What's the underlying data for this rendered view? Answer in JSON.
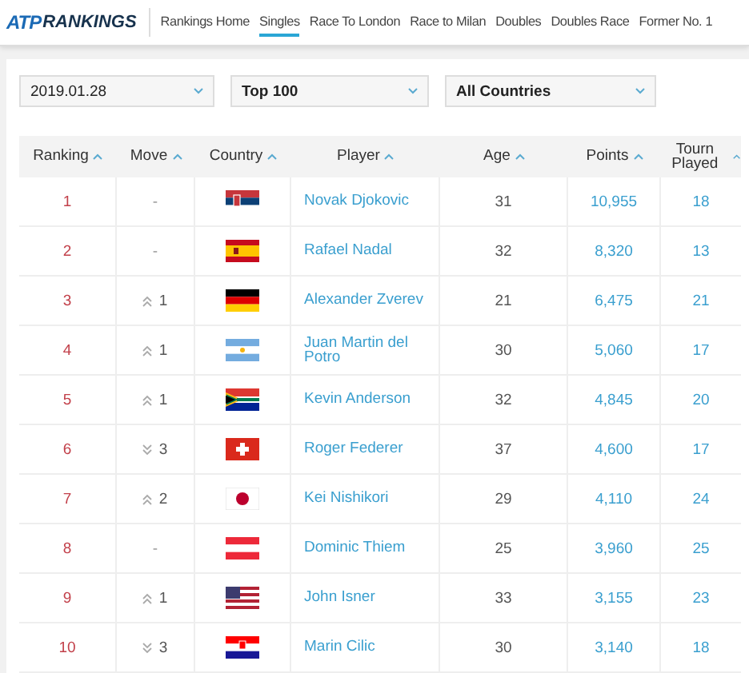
{
  "brand": {
    "logo": "ATP",
    "title": "RANKINGS"
  },
  "nav": [
    {
      "label": "Rankings Home",
      "selected": false
    },
    {
      "label": "Singles",
      "selected": true
    },
    {
      "label": "Race To London",
      "selected": false
    },
    {
      "label": "Race to Milan",
      "selected": false
    },
    {
      "label": "Doubles",
      "selected": false
    },
    {
      "label": "Doubles Race",
      "selected": false
    },
    {
      "label": "Former No. 1",
      "selected": false
    }
  ],
  "filters": [
    {
      "value": "2019.01.28",
      "bold": false
    },
    {
      "value": "Top 100",
      "bold": true
    },
    {
      "value": "All Countries",
      "bold": true
    }
  ],
  "table": {
    "columns": [
      "Ranking",
      "Move",
      "Country",
      "Player",
      "Age",
      "Points",
      "Tourn Played"
    ],
    "rows": [
      {
        "ranking": "1",
        "move": {
          "kind": "none",
          "text": "-"
        },
        "flag": {
          "kind": "RS"
        },
        "player": "Novak Djokovic",
        "age": "31",
        "points": "10,955",
        "played": "18"
      },
      {
        "ranking": "2",
        "move": {
          "kind": "none",
          "text": "-"
        },
        "flag": {
          "kind": "ES"
        },
        "player": "Rafael Nadal",
        "age": "32",
        "points": "8,320",
        "played": "13"
      },
      {
        "ranking": "3",
        "move": {
          "kind": "up",
          "text": "1"
        },
        "flag": {
          "kind": "DE"
        },
        "player": "Alexander Zverev",
        "age": "21",
        "points": "6,475",
        "played": "21"
      },
      {
        "ranking": "4",
        "move": {
          "kind": "up",
          "text": "1"
        },
        "flag": {
          "kind": "AR"
        },
        "player": "Juan Martin del Potro",
        "age": "30",
        "points": "5,060",
        "played": "17"
      },
      {
        "ranking": "5",
        "move": {
          "kind": "up",
          "text": "1"
        },
        "flag": {
          "kind": "ZA"
        },
        "player": "Kevin Anderson",
        "age": "32",
        "points": "4,845",
        "played": "20"
      },
      {
        "ranking": "6",
        "move": {
          "kind": "down",
          "text": "3"
        },
        "flag": {
          "kind": "CH"
        },
        "player": "Roger Federer",
        "age": "37",
        "points": "4,600",
        "played": "17"
      },
      {
        "ranking": "7",
        "move": {
          "kind": "up",
          "text": "2"
        },
        "flag": {
          "kind": "JP"
        },
        "player": "Kei Nishikori",
        "age": "29",
        "points": "4,110",
        "played": "24"
      },
      {
        "ranking": "8",
        "move": {
          "kind": "none",
          "text": "-"
        },
        "flag": {
          "kind": "AT"
        },
        "player": "Dominic Thiem",
        "age": "25",
        "points": "3,960",
        "played": "25"
      },
      {
        "ranking": "9",
        "move": {
          "kind": "up",
          "text": "1"
        },
        "flag": {
          "kind": "US"
        },
        "player": "John Isner",
        "age": "33",
        "points": "3,155",
        "played": "23"
      },
      {
        "ranking": "10",
        "move": {
          "kind": "down",
          "text": "3"
        },
        "flag": {
          "kind": "HR"
        },
        "player": "Marin Cilic",
        "age": "30",
        "points": "3,140",
        "played": "18"
      }
    ]
  }
}
